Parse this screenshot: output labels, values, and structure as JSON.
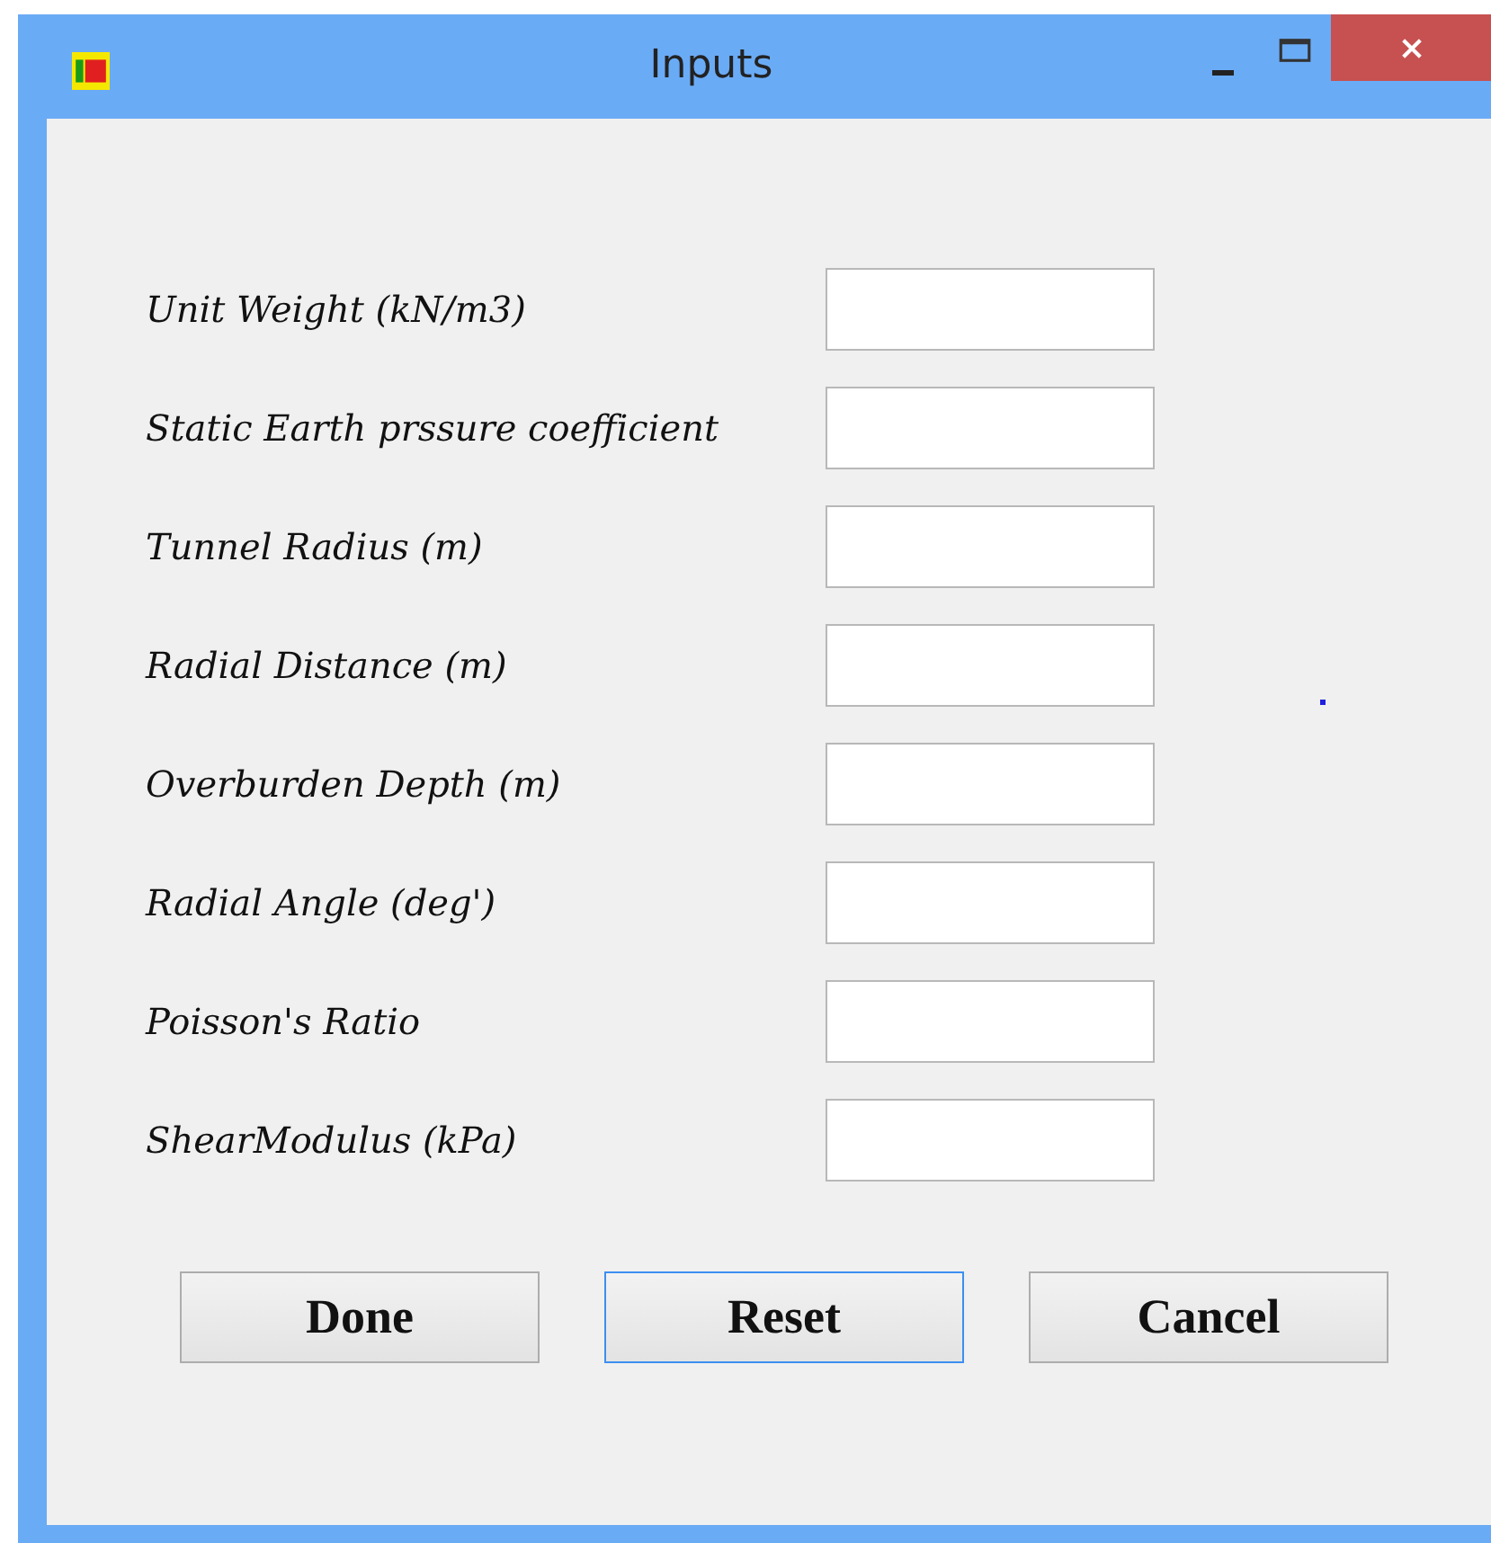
{
  "window": {
    "title": "Inputs"
  },
  "fields": [
    {
      "label": "Unit Weight (kN/m3)"
    },
    {
      "label": "Static Earth prssure coefficient"
    },
    {
      "label": "Tunnel Radius (m)"
    },
    {
      "label": "Radial Distance (m)"
    },
    {
      "label": "Overburden Depth (m)"
    },
    {
      "label": "Radial Angle (deg')"
    },
    {
      "label": "Poisson's Ratio"
    },
    {
      "label": "ShearModulus (kPa)"
    }
  ],
  "buttons": [
    {
      "label": "Done",
      "focused": false
    },
    {
      "label": "Reset",
      "focused": true
    },
    {
      "label": "Cancel",
      "focused": false
    }
  ]
}
